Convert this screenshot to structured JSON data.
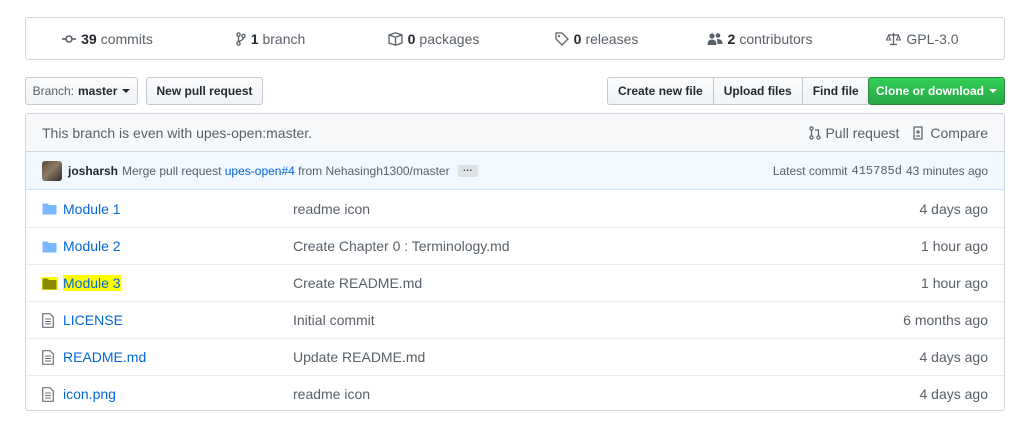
{
  "summary": {
    "commits": {
      "num": "39",
      "label": "commits",
      "icon": "commit-icon"
    },
    "branches": {
      "num": "1",
      "label": "branch",
      "icon": "branch-icon"
    },
    "packages": {
      "num": "0",
      "label": "packages",
      "icon": "package-icon"
    },
    "releases": {
      "num": "0",
      "label": "releases",
      "icon": "tag-icon"
    },
    "contributors": {
      "num": "2",
      "label": "contributors",
      "icon": "people-icon"
    },
    "license": {
      "label": "GPL-3.0",
      "icon": "law-icon"
    }
  },
  "toolbar": {
    "branch_prefix": "Branch:",
    "branch_name": "master",
    "new_pr": "New pull request",
    "create_file": "Create new file",
    "upload_files": "Upload files",
    "find_file": "Find file",
    "clone": "Clone or download"
  },
  "branch_info": {
    "text": "This branch is even with upes-open:master.",
    "pull_request": "Pull request",
    "compare": "Compare"
  },
  "commit": {
    "author": "josharsh",
    "msg_pre": "Merge pull request",
    "pr_link": "upes-open#4",
    "msg_post": "from Nehasingh1300/master",
    "ellipsis": "…",
    "latest_label": "Latest commit",
    "sha": "415785d",
    "age": "43 minutes ago"
  },
  "files": [
    {
      "type": "dir",
      "name": "Module 1",
      "message": "readme icon",
      "age": "4 days ago",
      "highlight": false
    },
    {
      "type": "dir",
      "name": "Module 2",
      "message": "Create Chapter 0 : Terminology.md",
      "age": "1 hour ago",
      "highlight": false
    },
    {
      "type": "dir",
      "name": "Module 3",
      "message": "Create README.md",
      "age": "1 hour ago",
      "highlight": true
    },
    {
      "type": "file",
      "name": "LICENSE",
      "message": "Initial commit",
      "age": "6 months ago",
      "highlight": false
    },
    {
      "type": "file",
      "name": "README.md",
      "message": "Update README.md",
      "age": "4 days ago",
      "highlight": false
    },
    {
      "type": "file",
      "name": "icon.png",
      "message": "readme icon",
      "age": "4 days ago",
      "highlight": false
    }
  ],
  "colors": {
    "link": "#0366d6",
    "folder": "#79b8ff",
    "highlight": "#ffff00",
    "green_button": "#28a745"
  }
}
